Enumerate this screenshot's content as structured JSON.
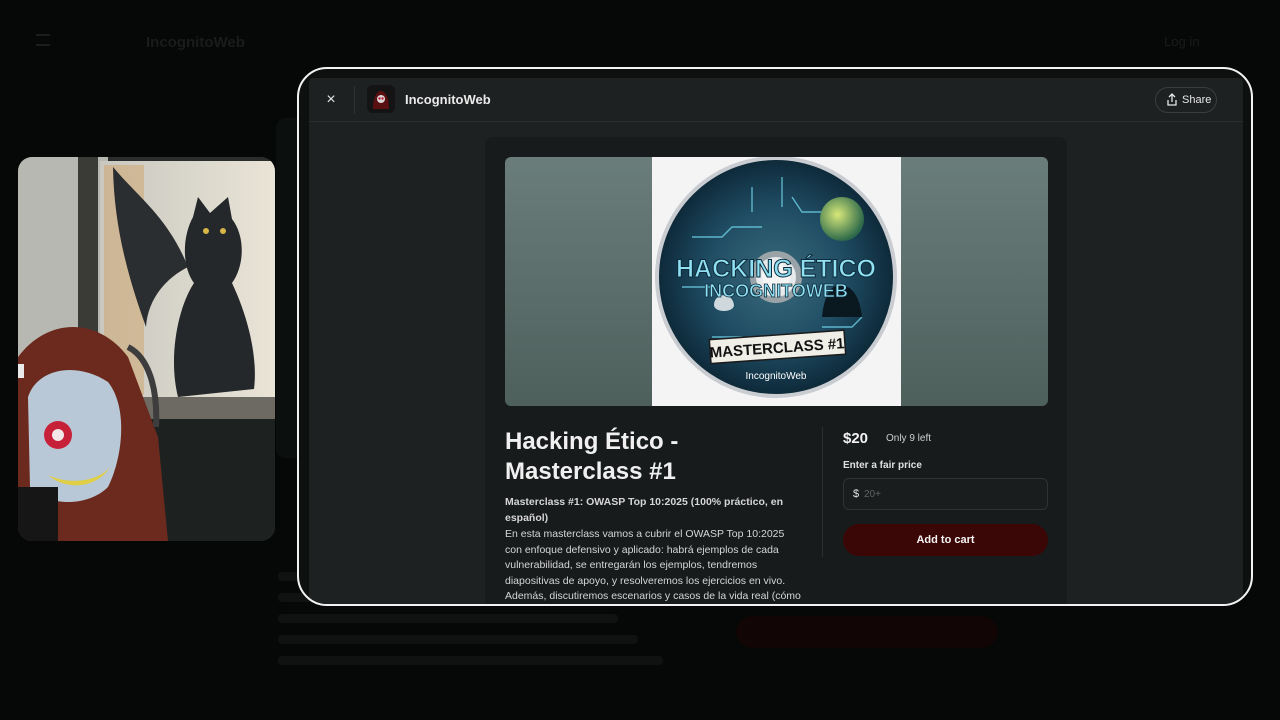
{
  "background_page": {
    "brand": "IncognitoWeb",
    "login": "Log in"
  },
  "modal": {
    "seller": "IncognitoWeb",
    "close_label": "×",
    "share_label": "Share"
  },
  "product": {
    "cover_text": {
      "line1": "HACKING ÉTICO",
      "line2": "INCOGNITOWEB",
      "badge": "MASTERCLASS #1",
      "brand": "IncognitoWeb"
    },
    "title": "Hacking Ético - Masterclass #1",
    "description_heading": "Masterclass #1: OWASP Top 10:2025 (100% práctico, en español)",
    "description_body": "En esta masterclass vamos a cubrir el OWASP Top 10:2025 con enfoque defensivo y aplicado: habrá ejemplos de cada vulnerabilidad, se entregarán los ejemplos, tendremos diapositivas de apoyo, y resolveremos los ejercicios en vivo. Además, discutiremos escenarios y casos de la vida real (cómo",
    "price": "$20",
    "stock": "Only 9 left",
    "fair_price_label": "Enter a fair price",
    "currency_symbol": "$",
    "price_placeholder": "20+",
    "cta": "Add to cart"
  },
  "colors": {
    "cta_background": "#3b0606",
    "modal_background": "#1e2122",
    "modal_border": "#f2f2f2"
  }
}
